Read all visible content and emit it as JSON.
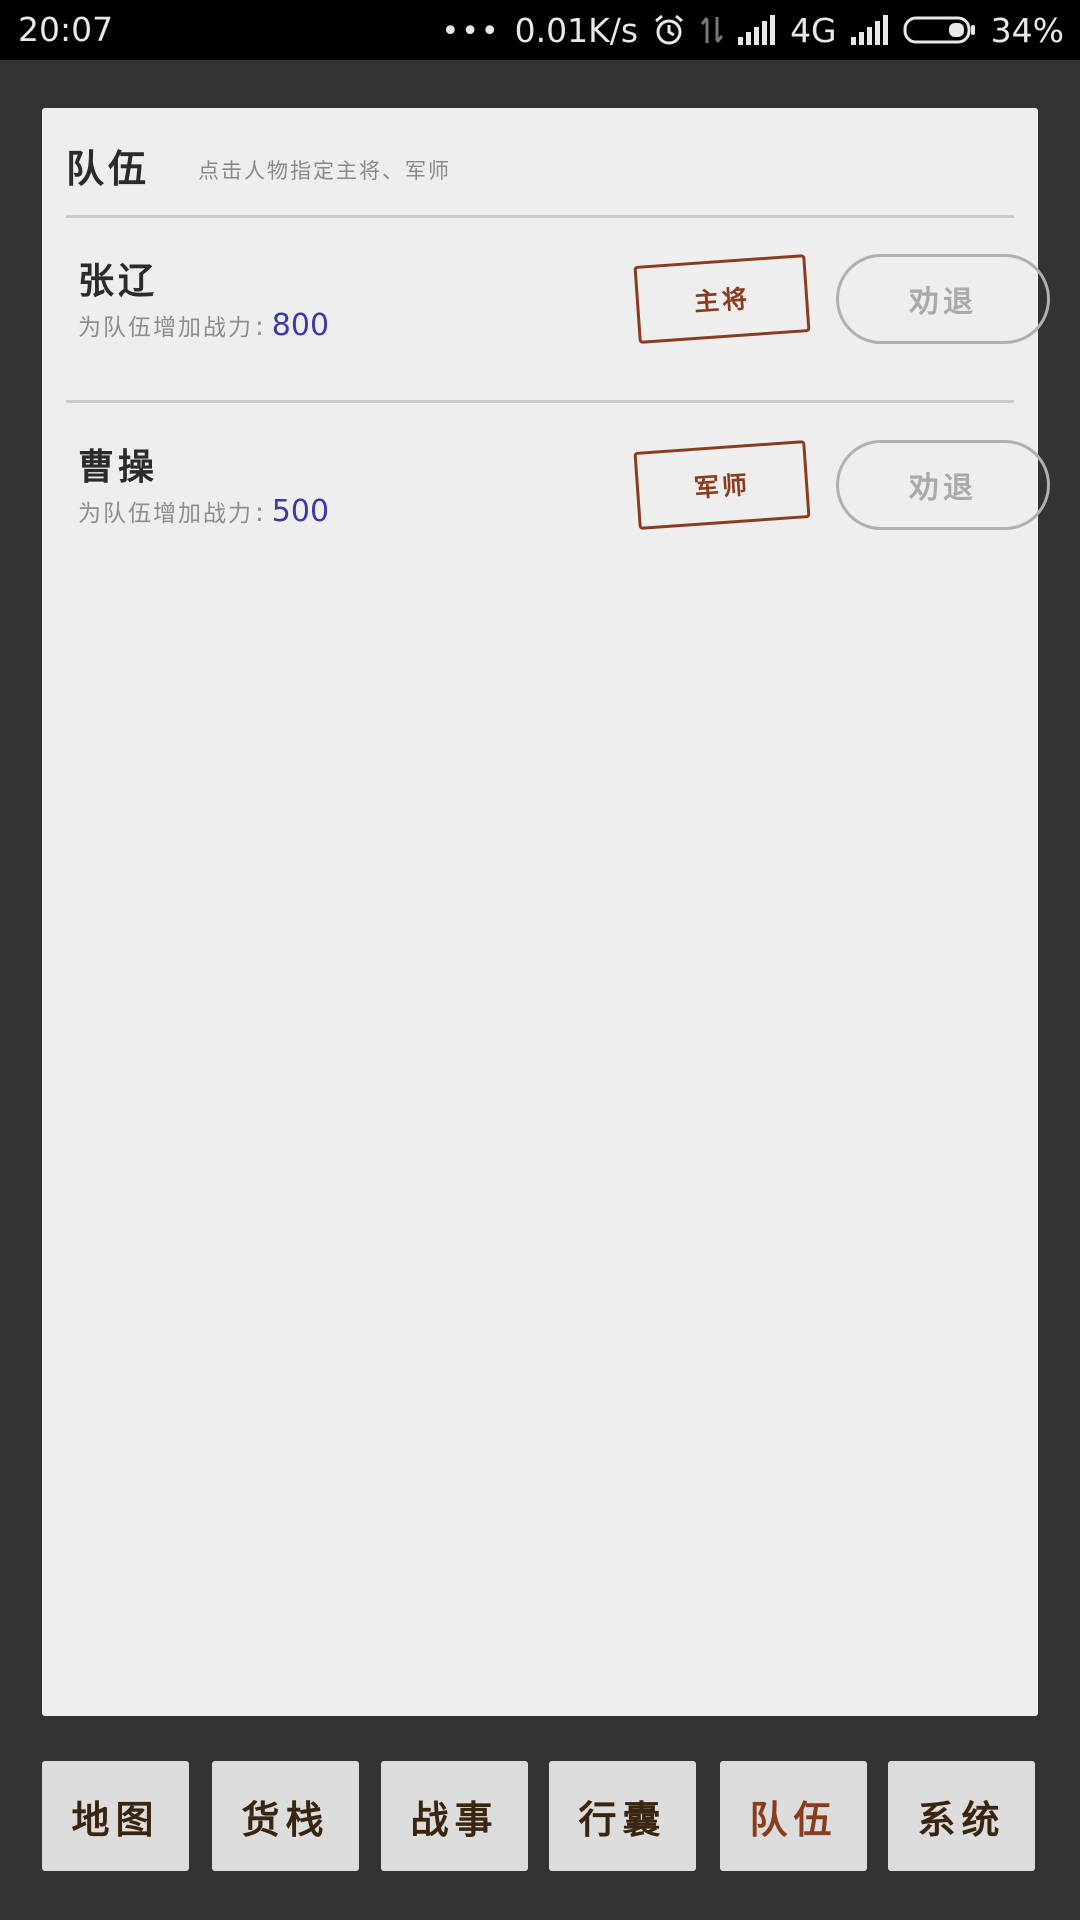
{
  "status_bar": {
    "time": "20:07",
    "dots": "•••",
    "net_speed": "0.01K/s",
    "network": "4G",
    "battery": "34%",
    "icons": [
      "alarm-icon",
      "data-arrows-icon",
      "signal-icon",
      "signal-icon",
      "battery-icon"
    ]
  },
  "team": {
    "title": "队伍",
    "subtitle": "点击人物指定主将、军师",
    "power_colon": ":",
    "members": [
      {
        "name": "张辽",
        "power_label": "为队伍增加战力",
        "power_value": "800",
        "role": "主将",
        "dismiss_label": "劝退"
      },
      {
        "name": "曹操",
        "power_label": "为队伍增加战力",
        "power_value": "500",
        "role": "军师",
        "dismiss_label": "劝退"
      }
    ]
  },
  "nav": {
    "items": [
      {
        "label": "地图"
      },
      {
        "label": "货栈"
      },
      {
        "label": "战事"
      },
      {
        "label": "行囊"
      },
      {
        "label": "队伍"
      },
      {
        "label": "系统"
      }
    ],
    "active": "队伍"
  },
  "colors": {
    "background": "#333333",
    "card": "#eeeeee",
    "stamp": "#8a3c1e",
    "power_value": "#3a3aa8",
    "nav_button": "#dddddd"
  }
}
